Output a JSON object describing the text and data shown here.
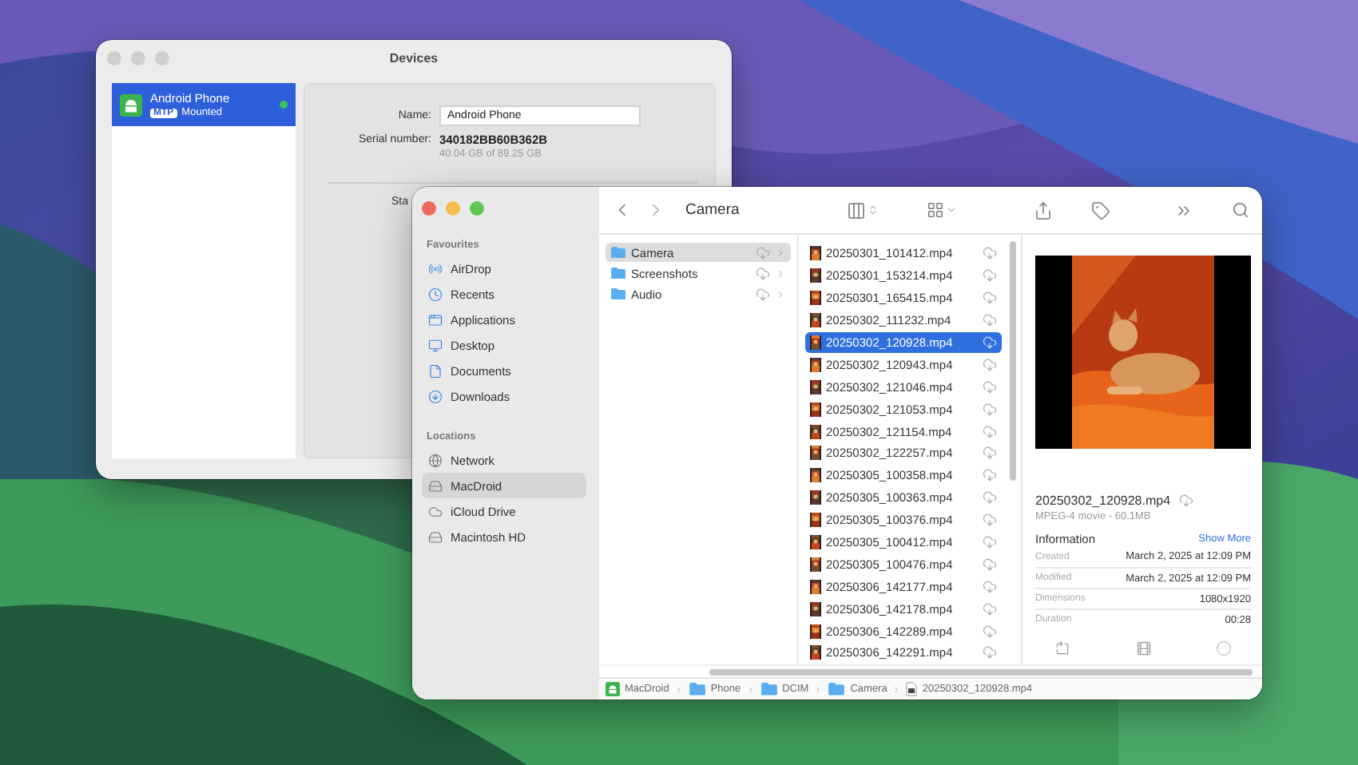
{
  "devices_window": {
    "title": "Devices",
    "devices": [
      {
        "name": "Android Phone",
        "protocol": "MTP",
        "status": "Mounted",
        "connected": true,
        "selected": true
      }
    ],
    "details": {
      "name_label": "Name:",
      "name_value": "Android Phone",
      "serial_label": "Serial number:",
      "serial_value": "340182BB60B362B",
      "storage": "40.04 GB of 89.25 GB",
      "status_label": "Sta"
    }
  },
  "finder": {
    "title": "Camera",
    "sidebar": [
      {
        "heading": "Favourites",
        "items": [
          {
            "label": "AirDrop",
            "kind": "airdrop",
            "selected": false
          },
          {
            "label": "Recents",
            "kind": "recents",
            "selected": false
          },
          {
            "label": "Applications",
            "kind": "applications",
            "selected": false
          },
          {
            "label": "Desktop",
            "kind": "desktop",
            "selected": false
          },
          {
            "label": "Documents",
            "kind": "documents",
            "selected": false
          },
          {
            "label": "Downloads",
            "kind": "downloads",
            "selected": false
          }
        ]
      },
      {
        "heading": "Locations",
        "items": [
          {
            "label": "Network",
            "kind": "network",
            "selected": false
          },
          {
            "label": "MacDroid",
            "kind": "drive",
            "selected": true
          },
          {
            "label": "iCloud Drive",
            "kind": "cloud",
            "selected": false
          },
          {
            "label": "Macintosh HD",
            "kind": "disk",
            "selected": false
          }
        ]
      }
    ],
    "folders": [
      {
        "name": "Camera",
        "selected": true
      },
      {
        "name": "Screenshots",
        "selected": false
      },
      {
        "name": "Audio",
        "selected": false
      }
    ],
    "files": [
      {
        "name": "20250301_101412.mp4",
        "selected": false
      },
      {
        "name": "20250301_153214.mp4",
        "selected": false
      },
      {
        "name": "20250301_165415.mp4",
        "selected": false
      },
      {
        "name": "20250302_111232.mp4",
        "selected": false
      },
      {
        "name": "20250302_120928.mp4",
        "selected": true
      },
      {
        "name": "20250302_120943.mp4",
        "selected": false
      },
      {
        "name": "20250302_121046.mp4",
        "selected": false
      },
      {
        "name": "20250302_121053.mp4",
        "selected": false
      },
      {
        "name": "20250302_121154.mp4",
        "selected": false
      },
      {
        "name": "20250302_122257.mp4",
        "selected": false
      },
      {
        "name": "20250305_100358.mp4",
        "selected": false
      },
      {
        "name": "20250305_100363.mp4",
        "selected": false
      },
      {
        "name": "20250305_100376.mp4",
        "selected": false
      },
      {
        "name": "20250305_100412.mp4",
        "selected": false
      },
      {
        "name": "20250305_100476.mp4",
        "selected": false
      },
      {
        "name": "20250306_142177.mp4",
        "selected": false
      },
      {
        "name": "20250306_142178.mp4",
        "selected": false
      },
      {
        "name": "20250306_142289.mp4",
        "selected": false
      },
      {
        "name": "20250306_142291.mp4",
        "selected": false
      }
    ],
    "preview": {
      "file_name": "20250302_120928.mp4",
      "kind": "MPEG-4 movie - 60.1MB",
      "info_heading": "Information",
      "show_more": "Show More",
      "info": [
        {
          "label": "Created",
          "value": "March 2, 2025 at 12:09 PM"
        },
        {
          "label": "Modified",
          "value": "March 2, 2025 at 12:09 PM"
        },
        {
          "label": "Dimensions",
          "value": "1080x1920"
        },
        {
          "label": "Duration",
          "value": "00:28"
        }
      ]
    },
    "path": [
      {
        "label": "MacDroid",
        "kind": "device"
      },
      {
        "label": "Phone",
        "kind": "folder"
      },
      {
        "label": "DCIM",
        "kind": "folder"
      },
      {
        "label": "Camera",
        "kind": "folder"
      },
      {
        "label": "20250302_120928.mp4",
        "kind": "file"
      }
    ]
  }
}
